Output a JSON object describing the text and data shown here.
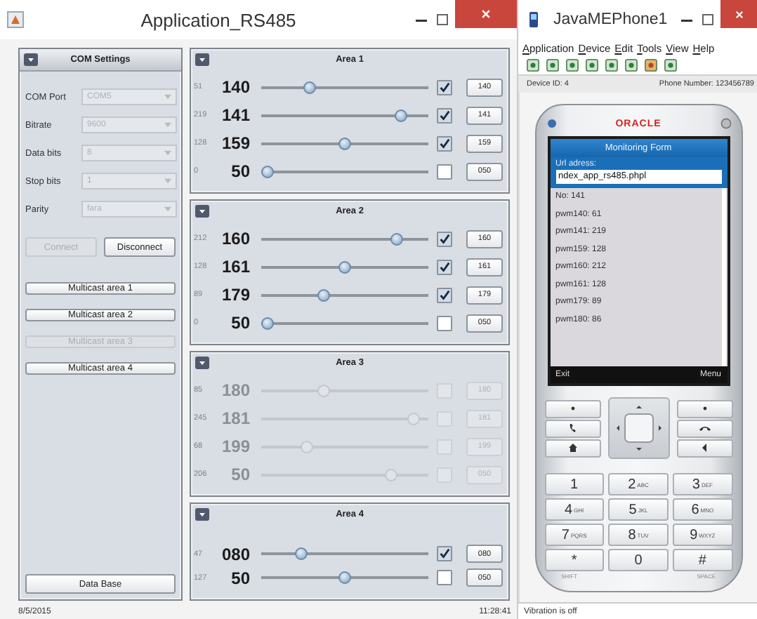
{
  "app_window": {
    "title": "Application_RS485",
    "com_settings": {
      "title": "COM Settings",
      "fields": [
        {
          "label": "COM Port",
          "value": "COM5",
          "disabled": true
        },
        {
          "label": "Bitrate",
          "value": "9600",
          "disabled": true
        },
        {
          "label": "Data bits",
          "value": "8",
          "disabled": true
        },
        {
          "label": "Stop bits",
          "value": "1",
          "disabled": true
        },
        {
          "label": "Parity",
          "value": "fara",
          "disabled": true
        }
      ],
      "buttons": [
        {
          "label": "Connect",
          "disabled": true
        },
        {
          "label": "Disconnect",
          "disabled": false
        }
      ],
      "multicast_buttons": [
        {
          "label": "Multicast area 1",
          "disabled": false
        },
        {
          "label": "Multicast area 2",
          "disabled": false
        },
        {
          "label": "Multicast area 3",
          "disabled": true
        },
        {
          "label": "Multicast area 4",
          "disabled": false
        }
      ],
      "database_button": "Data Base"
    },
    "areas": [
      {
        "title": "Area 1",
        "disabled": false,
        "rows": [
          {
            "raw": "51",
            "value": "140",
            "level": 0.27,
            "checked": true,
            "button": "140"
          },
          {
            "raw": "219",
            "value": "141",
            "level": 0.86,
            "checked": true,
            "button": "141"
          },
          {
            "raw": "128",
            "value": "159",
            "level": 0.5,
            "checked": true,
            "button": "159"
          },
          {
            "raw": "0",
            "value": "50",
            "level": 0,
            "checked": false,
            "button": "050"
          }
        ]
      },
      {
        "title": "Area 2",
        "disabled": false,
        "rows": [
          {
            "raw": "212",
            "value": "160",
            "level": 0.84,
            "checked": true,
            "button": "160"
          },
          {
            "raw": "128",
            "value": "161",
            "level": 0.5,
            "checked": true,
            "button": "161"
          },
          {
            "raw": "89",
            "value": "179",
            "level": 0.36,
            "checked": true,
            "button": "179"
          },
          {
            "raw": "0",
            "value": "50",
            "level": 0,
            "checked": false,
            "button": "050"
          }
        ]
      },
      {
        "title": "Area 3",
        "disabled": true,
        "rows": [
          {
            "raw": "85",
            "value": "180",
            "level": 0.36,
            "checked": false,
            "button": "180"
          },
          {
            "raw": "245",
            "value": "181",
            "level": 0.95,
            "checked": false,
            "button": "181"
          },
          {
            "raw": "68",
            "value": "199",
            "level": 0.25,
            "checked": false,
            "button": "199"
          },
          {
            "raw": "206",
            "value": "50",
            "level": 0.8,
            "checked": false,
            "button": "050"
          }
        ]
      },
      {
        "title": "Area 4",
        "disabled": false,
        "rows": [
          {
            "raw": "47",
            "value": "080",
            "level": 0.22,
            "checked": true,
            "button": "080"
          },
          {
            "raw": "127",
            "value": "50",
            "level": 0.5,
            "checked": false,
            "button": "050"
          }
        ]
      }
    ],
    "status_bar": {
      "date": "8/5/2015",
      "time": "11:28:41"
    }
  },
  "phone_window": {
    "title": "JavaMEPhone1",
    "menu": [
      "Application",
      "Device",
      "Edit",
      "Tools",
      "View",
      "Help"
    ],
    "device_id": "Device ID: 4",
    "phone_number": "Phone Number: 123456789",
    "brand": "ORACLE",
    "form_title": "Monitoring Form",
    "url_label": "Url adress:",
    "url_value": "ndex_app_rs485.phpl",
    "items": [
      "No: 141",
      "pwm140: 61",
      "pwm141: 219",
      "pwm159: 128",
      "pwm160: 212",
      "pwm161: 128",
      "pwm179: 89",
      "pwm180: 86"
    ],
    "soft_keys": [
      "Exit",
      "Menu"
    ],
    "keys": [
      {
        "digit": "1"
      },
      {
        "digit": "2",
        "letters": "ABC"
      },
      {
        "digit": "3",
        "letters": "DEF"
      },
      {
        "digit": "4",
        "letters": "GHI"
      },
      {
        "digit": "5",
        "letters": "JKL"
      },
      {
        "digit": "6",
        "letters": "MNO"
      },
      {
        "digit": "7",
        "letters": "PQRS"
      },
      {
        "digit": "8",
        "letters": "TUV"
      },
      {
        "digit": "9",
        "letters": "WXYZ"
      },
      {
        "digit": "*"
      },
      {
        "digit": "0"
      },
      {
        "digit": "#"
      }
    ],
    "shift_label": "SHIFT",
    "space_label": "SPACE",
    "status": "Vibration is off"
  }
}
